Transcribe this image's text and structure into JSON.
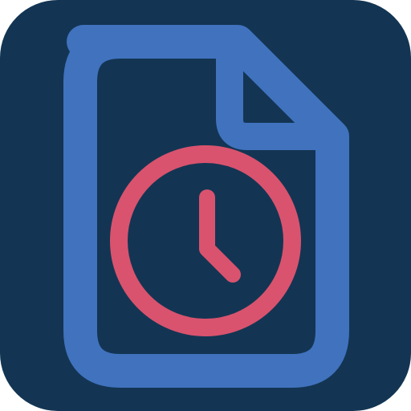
{
  "icon": {
    "name": "file-clock-icon",
    "parts": [
      "app-tile",
      "document-icon",
      "clock-icon"
    ]
  },
  "colors": {
    "tile": "#133553",
    "document": "#4072BE",
    "clock": "#D9536E"
  }
}
